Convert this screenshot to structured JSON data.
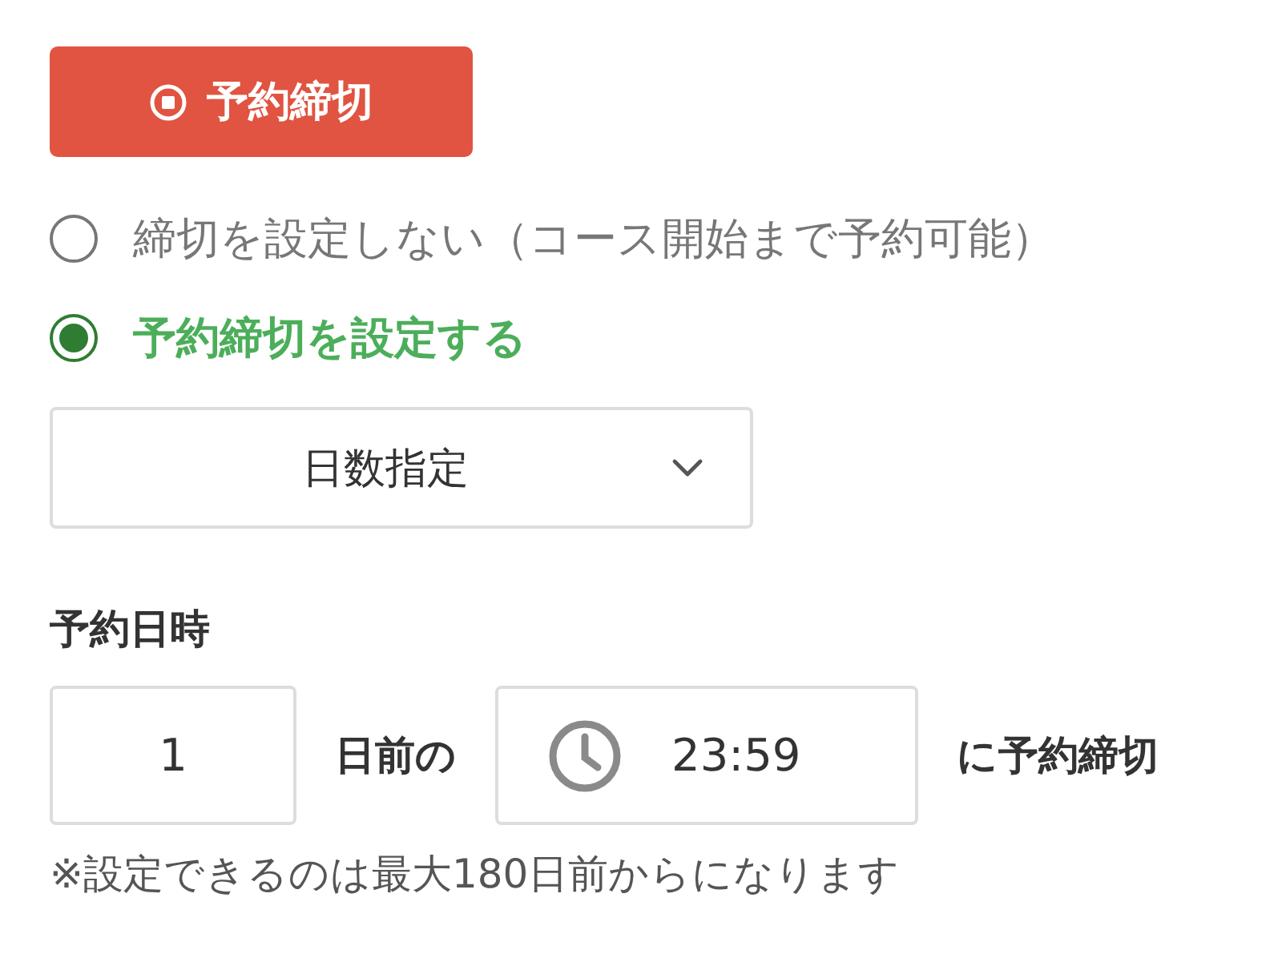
{
  "header_button": {
    "label": "予約締切"
  },
  "options": [
    {
      "label": "締切を設定しない（コース開始まで予約可能）",
      "selected": false
    },
    {
      "label": "予約締切を設定する",
      "selected": true
    }
  ],
  "mode_select": {
    "value": "日数指定"
  },
  "section_label": "予約日時",
  "days_field": {
    "value": "1"
  },
  "days_suffix": "日前の",
  "time_field": {
    "value": "23:59"
  },
  "time_suffix": "に予約締切",
  "note": "※設定できるのは最大180日前からになります"
}
